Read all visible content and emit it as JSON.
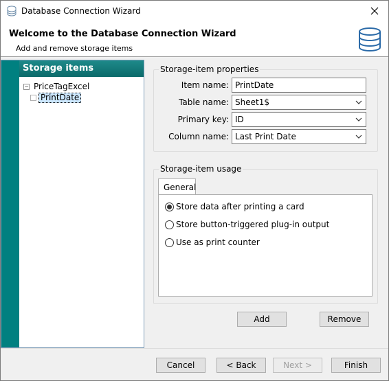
{
  "window": {
    "title": "Database Connection Wizard",
    "close_icon": "close-icon"
  },
  "header": {
    "title": "Welcome to the Database Connection Wizard",
    "subtitle": "Add and remove storage items",
    "icon": "database-icon"
  },
  "left_pane": {
    "title": "Storage items",
    "tree": {
      "root": "PriceTagExcel",
      "child": "PrintDate"
    }
  },
  "properties": {
    "group_title": "Storage-item properties",
    "item_name": {
      "label": "Item name:",
      "value": "PrintDate"
    },
    "table_name": {
      "label": "Table name:",
      "value": "Sheet1$"
    },
    "primary_key": {
      "label": "Primary key:",
      "value": "ID"
    },
    "column_name": {
      "label": "Column name:",
      "value": "Last Print Date"
    }
  },
  "usage": {
    "group_title": "Storage-item usage",
    "tab": "General",
    "options": [
      {
        "label": "Store data after printing a card",
        "checked": true
      },
      {
        "label": "Store button-triggered plug-in output",
        "checked": false
      },
      {
        "label": "Use as print counter",
        "checked": false
      }
    ]
  },
  "actions": {
    "add": "Add",
    "remove": "Remove"
  },
  "footer": {
    "cancel": "Cancel",
    "back": "< Back",
    "next": "Next >",
    "finish": "Finish"
  },
  "colors": {
    "accent": "#008080",
    "selection": "#cde8ff"
  }
}
